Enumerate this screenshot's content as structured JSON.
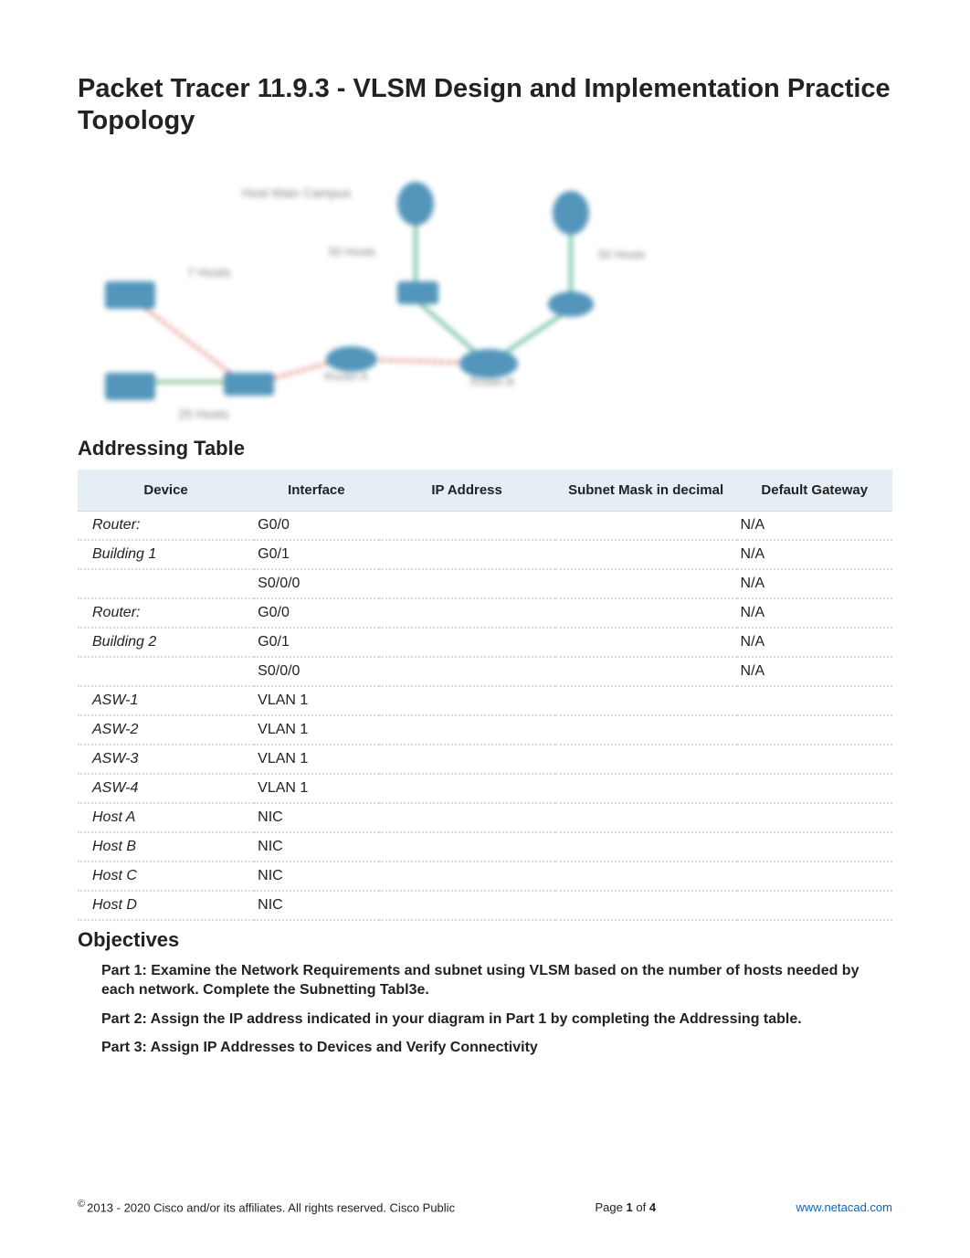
{
  "title": "Packet Tracer 11.9.3 - VLSM Design and Implementation Practice Topology",
  "sections": {
    "addressing_table": "Addressing Table",
    "objectives": "Objectives"
  },
  "topology_labels": {
    "top_left": "Host Main Campus",
    "mid_left": "7 Hosts",
    "center_cloud": "50 Hosts",
    "center_router": "Router-A",
    "right_router": "Router-B",
    "bottom_left": "25 Hosts",
    "right_cloud": "50 Hosts"
  },
  "table": {
    "headers": {
      "device": "Device",
      "interface": "Interface",
      "ip": "IP Address",
      "mask": "Subnet Mask in decimal",
      "gw": "Default Gateway"
    },
    "rows": [
      {
        "device": "Router:",
        "interface": "G0/0",
        "ip": "",
        "mask": "",
        "gw": "N/A"
      },
      {
        "device": "Building 1",
        "interface": "G0/1",
        "ip": "",
        "mask": "",
        "gw": "N/A"
      },
      {
        "device": "",
        "interface": "S0/0/0",
        "ip": "",
        "mask": "",
        "gw": "N/A"
      },
      {
        "device": "Router:",
        "interface": "G0/0",
        "ip": "",
        "mask": "",
        "gw": "N/A"
      },
      {
        "device": "Building 2",
        "interface": "G0/1",
        "ip": "",
        "mask": "",
        "gw": "N/A"
      },
      {
        "device": "",
        "interface": "S0/0/0",
        "ip": "",
        "mask": "",
        "gw": "N/A"
      },
      {
        "device": "ASW-1",
        "interface": "VLAN 1",
        "ip": "",
        "mask": "",
        "gw": ""
      },
      {
        "device": "ASW-2",
        "interface": "VLAN 1",
        "ip": "",
        "mask": "",
        "gw": ""
      },
      {
        "device": "ASW-3",
        "interface": "VLAN 1",
        "ip": "",
        "mask": "",
        "gw": ""
      },
      {
        "device": "ASW-4",
        "interface": "VLAN 1",
        "ip": "",
        "mask": "",
        "gw": ""
      },
      {
        "device": "Host A",
        "interface": "NIC",
        "ip": "",
        "mask": "",
        "gw": ""
      },
      {
        "device": "Host B",
        "interface": "NIC",
        "ip": "",
        "mask": "",
        "gw": ""
      },
      {
        "device": "Host C",
        "interface": "NIC",
        "ip": "",
        "mask": "",
        "gw": ""
      },
      {
        "device": "Host D",
        "interface": "NIC",
        "ip": "",
        "mask": "",
        "gw": ""
      }
    ]
  },
  "objectives": [
    "Part 1: Examine the Network Requirements and subnet using VLSM based on the number of hosts needed by each network. Complete the Subnetting Tabl3e.",
    "Part 2: Assign the IP address indicated in your diagram in Part 1 by completing the Addressing table.",
    "Part 3: Assign IP Addresses to Devices and Verify Connectivity"
  ],
  "footer": {
    "copyright": "2013 - 2020 Cisco and/or its affiliates. All rights reserved. Cisco Public",
    "page_label_prefix": "Page ",
    "page_current": "1",
    "page_of": " of ",
    "page_total": "4",
    "link": "www.netacad.com"
  }
}
